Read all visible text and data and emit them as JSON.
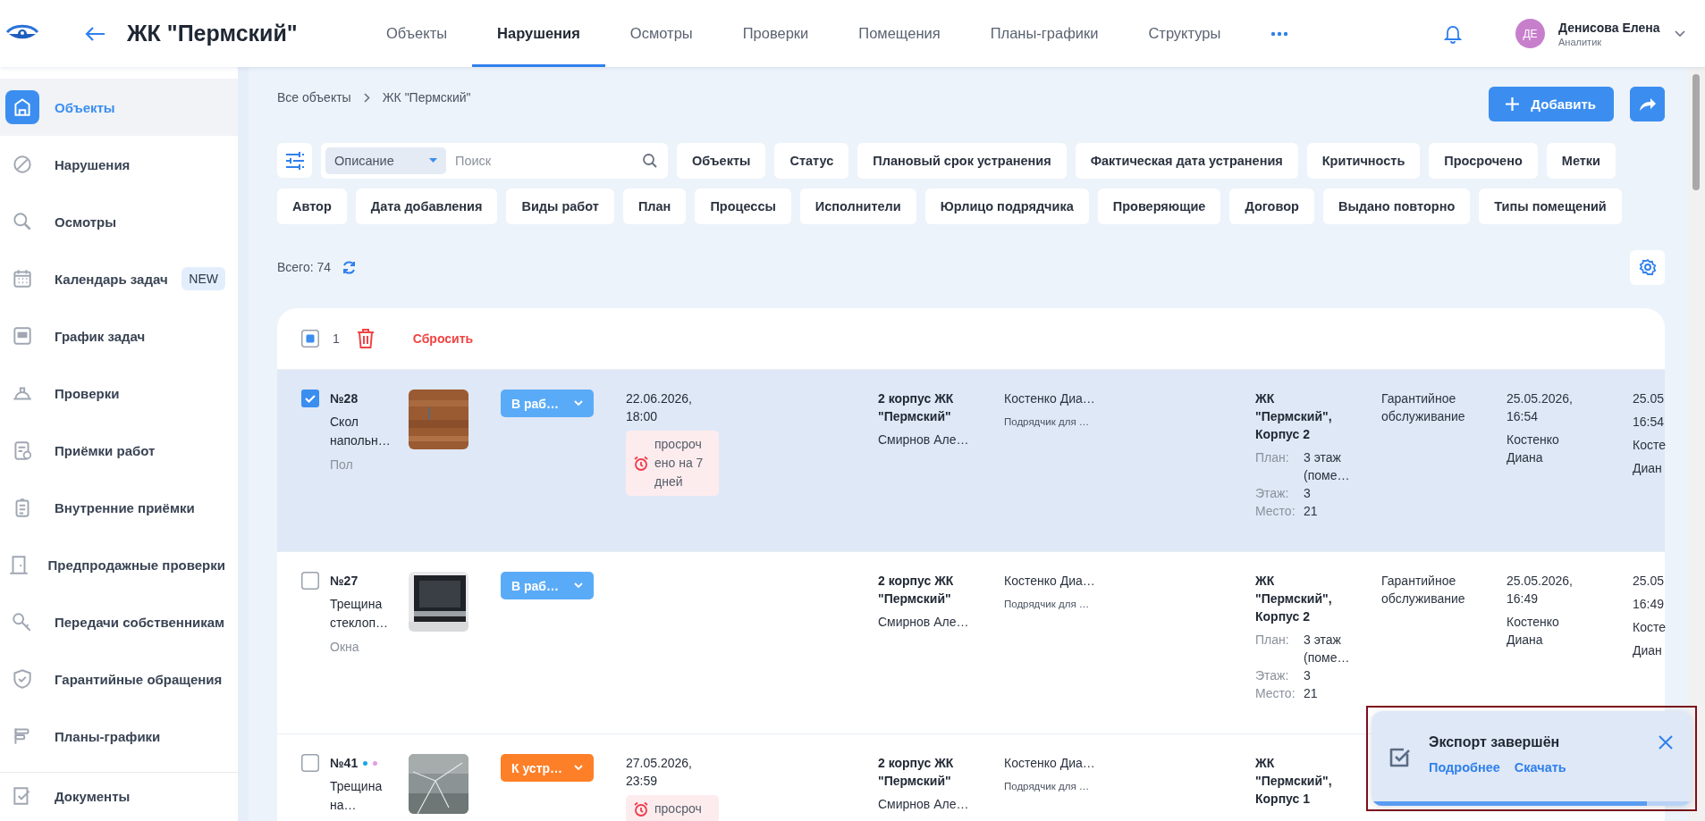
{
  "header": {
    "title": "ЖК \"Пермский\"",
    "nav": [
      {
        "label": "Объекты",
        "selected": false
      },
      {
        "label": "Нарушения",
        "selected": true
      },
      {
        "label": "Осмотры",
        "selected": false
      },
      {
        "label": "Проверки",
        "selected": false
      },
      {
        "label": "Помещения",
        "selected": false
      },
      {
        "label": "Планы-графики",
        "selected": false
      },
      {
        "label": "Структуры",
        "selected": false
      }
    ],
    "user": {
      "initials": "ДЕ",
      "name": "Денисова Елена",
      "role": "Аналитик"
    }
  },
  "sidebar": {
    "items": [
      {
        "label": "Объекты",
        "selected": true
      },
      {
        "label": "Нарушения",
        "selected": false
      },
      {
        "label": "Осмотры",
        "selected": false
      },
      {
        "label": "Календарь задач",
        "selected": false,
        "badge": "NEW"
      },
      {
        "label": "График задач",
        "selected": false
      },
      {
        "label": "Проверки",
        "selected": false
      },
      {
        "label": "Приёмки работ",
        "selected": false
      },
      {
        "label": "Внутренние приёмки",
        "selected": false
      },
      {
        "label": "Предпродажные проверки",
        "selected": false
      },
      {
        "label": "Передачи собственникам",
        "selected": false
      },
      {
        "label": "Гарантийные обращения",
        "selected": false
      },
      {
        "label": "Планы-графики",
        "selected": false
      }
    ],
    "footer_items": [
      {
        "label": "Документы",
        "selected": false
      }
    ]
  },
  "breadcrumbs": [
    "Все объекты",
    "ЖК \"Пермский\""
  ],
  "add_button": "Добавить",
  "search": {
    "field": "Описание",
    "placeholder": "Поиск"
  },
  "filters": [
    "Объекты",
    "Статус",
    "Плановый срок устранения",
    "Фактическая дата устранения",
    "Критичность",
    "Просрочено",
    "Метки",
    "Автор",
    "Дата добавления",
    "Виды работ",
    "План",
    "Процессы",
    "Исполнители",
    "Юрлицо подрядчика",
    "Проверяющие",
    "Договор",
    "Выдано повторно",
    "Типы помещений"
  ],
  "total": "Всего: 74",
  "bulk": {
    "indeterminate": true,
    "count": "1",
    "reset": "Сбросить"
  },
  "rows": [
    {
      "selected": true,
      "number": "№28",
      "tags": [],
      "title": "Скол напольн…",
      "category": "Пол",
      "photo": {
        "kind": "picture"
      },
      "status": {
        "label": "В раб…",
        "kind": "in_work"
      },
      "due": "22.06.2026, 18:00",
      "overdue": "просрочено на 7 дней",
      "object": "2 корпус ЖК \"Пермский\"",
      "object_person": "Смирнов Але…",
      "contractor": "Костенко Диа…",
      "contractor_role": "Подрядчик для …",
      "location": {
        "title": "ЖК \"Пермский\", Корпус 2",
        "details": [
          {
            "label": "План:",
            "value": "3 этаж (поме…"
          },
          {
            "label": "Этаж:",
            "value": "3"
          },
          {
            "label": "Место:",
            "value": "21"
          }
        ]
      },
      "type": "Гарантийное обслуживание",
      "created": "25.05.2026, 16:54",
      "created_by": "Костенко Диана",
      "column_9": [
        "25.05",
        "16:54",
        "Косте",
        "Диан"
      ]
    },
    {
      "selected": false,
      "number": "№27",
      "tags": [],
      "title": "Трещина стеклоп…",
      "category": "Окна",
      "photo": {
        "kind": "picture"
      },
      "status": {
        "label": "В раб…",
        "kind": "in_work"
      },
      "object": "2 корпус ЖК \"Пермский\"",
      "object_person": "Смирнов Але…",
      "contractor": "Костенко Диа…",
      "contractor_role": "Подрядчик для …",
      "location": {
        "title": "ЖК \"Пермский\", Корпус 2",
        "details": [
          {
            "label": "План:",
            "value": "3 этаж (поме…"
          },
          {
            "label": "Этаж:",
            "value": "3"
          },
          {
            "label": "Место:",
            "value": "21"
          }
        ]
      },
      "type": "Гарантийное обслуживание",
      "created": "25.05.2026, 16:49",
      "created_by": "Костенко Диана",
      "column_9": [
        "25.05",
        "16:49",
        "Косте",
        "Диан"
      ]
    },
    {
      "selected": false,
      "number": "№41",
      "tags": [
        {
          "color": "#1aa6e8"
        },
        {
          "color": "#e79be0"
        }
      ],
      "title": "Трещина на…",
      "photo": {
        "kind": "picture"
      },
      "status": {
        "label": "К устр…",
        "kind": "to_fix"
      },
      "due": "27.05.2026, 23:59",
      "overdue": "просроч",
      "object": "2 корпус ЖК \"Пермский\"",
      "object_person": "Смирнов Але…",
      "contractor": "Костенко Диа…",
      "contractor_role": "Подрядчик для …",
      "location": {
        "title": "ЖК \"Пермский\", Корпус 1"
      }
    }
  ],
  "toast": {
    "title": "Экспорт завершён",
    "links": [
      "Подробнее",
      "Скачать"
    ],
    "level": 0.86
  }
}
